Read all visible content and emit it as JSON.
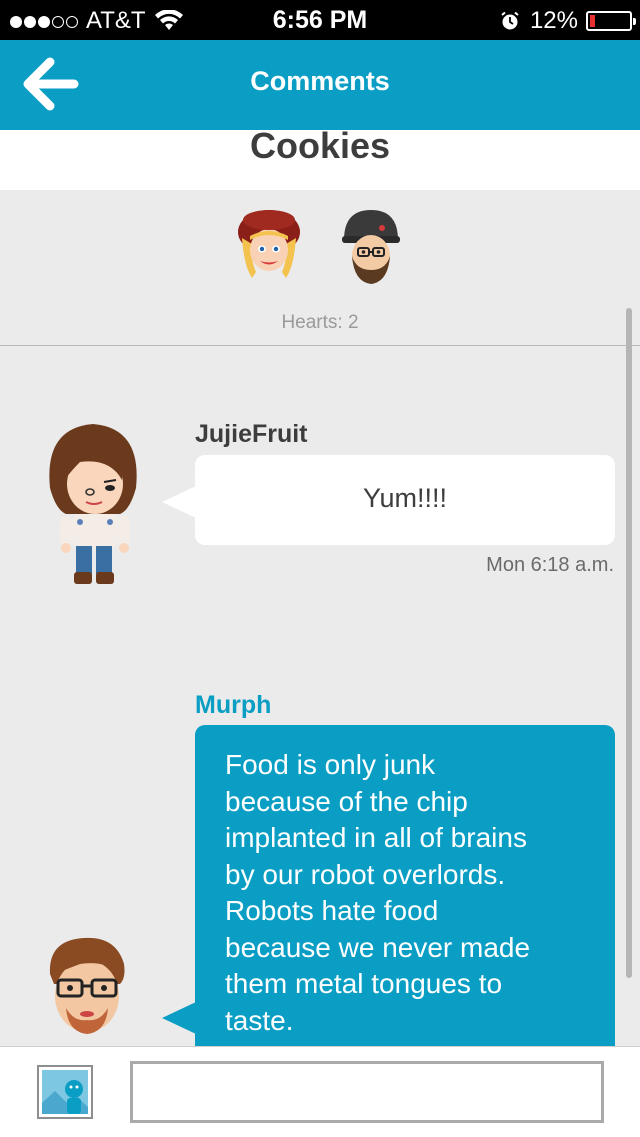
{
  "status_bar": {
    "carrier": "AT&T",
    "time": "6:56 PM",
    "battery_percent": "12%",
    "battery_level": 0.12,
    "signal_bars": 3,
    "signal_total": 5
  },
  "header": {
    "title": "Comments",
    "back_icon": "back-arrow-icon",
    "color": "#0a9ec4"
  },
  "post": {
    "title": "Cookies"
  },
  "hearts": {
    "label": "Hearts: 2"
  },
  "comments": [
    {
      "author": "JujieFruit",
      "text": "Yum!!!!",
      "timestamp": "Mon 6:18 a.m.",
      "author_color": "#3d3d3d",
      "bubble_color": "#ffffff"
    },
    {
      "author": "Murph",
      "text": "Food is only junk\nbecause of the chip\nimplanted in all of brains\nby our robot overlords.\nRobots hate food\nbecause we never made\nthem metal tongues to\ntaste.",
      "author_color": "#0a9ec4",
      "bubble_color": "#0a9ec4"
    }
  ],
  "compose": {
    "photo_icon": "photo-icon",
    "input_value": ""
  }
}
